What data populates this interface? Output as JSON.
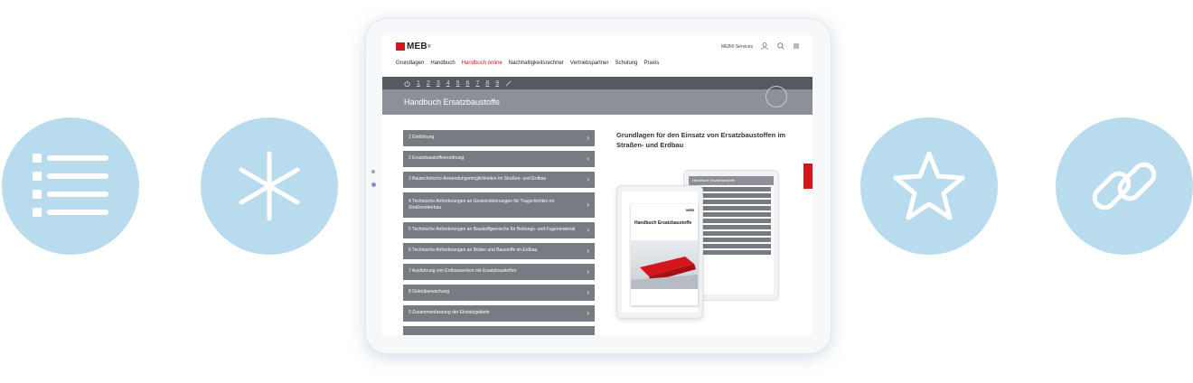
{
  "feature_icons": {
    "left": [
      "list-icon",
      "asterisk-icon"
    ],
    "right": [
      "star-icon",
      "link-icon"
    ],
    "circle_color": "#b9dbee"
  },
  "header": {
    "logo": "MEB",
    "logo_sup": "®",
    "services": "MEB® Services",
    "icons": [
      "user-icon",
      "search-icon",
      "menu-icon"
    ]
  },
  "nav": {
    "items": [
      "Grundlagen",
      "Handbuch",
      "Handbuch online",
      "Nachhaltigkeitsrechner",
      "Vertriebspartner",
      "Schulung",
      "Praxis"
    ],
    "active": "Handbuch online"
  },
  "chapter_bar": {
    "items": [
      "1",
      "2",
      "3",
      "4",
      "5",
      "6",
      "7",
      "8",
      "9"
    ]
  },
  "banner": {
    "title": "Handbuch Ersatzbaustoffe"
  },
  "chapters": [
    "1 Einführung",
    "2 Ersatzbaustoffverordnung",
    "3 Bautechnische Anwendungsmöglichkeiten im Straßen- und Erdbau",
    "4 Technische Anforderungen an Gesteinskörnungen für Tragschichten im Straßenoberbau",
    "5 Technische Anforderungen an Baustoffgemische für Bettungs- und Fugenmaterial",
    "6 Technische Anforderungen an Böden und Baustoffe im Erdbau",
    "7 Ausführung von Erdbauwerken mit Ersatzbaustoffen",
    "8 Güteüberwachung",
    "9 Zusammenfassung der Einsatzgebiete"
  ],
  "side_panel": {
    "title": "Grundlagen für den Einsatz von Ersatzbaustoffen im Straßen- und Erdbau",
    "mini_title": "Handbuch Ersatzbaustoffe",
    "cover_logo": "MEB",
    "cover_title": "Handbuch Ersatzbaustoffe"
  },
  "colors": {
    "accent": "#d4151c",
    "bar": "#555a60",
    "banner": "#8d9197",
    "item": "#777c82"
  }
}
